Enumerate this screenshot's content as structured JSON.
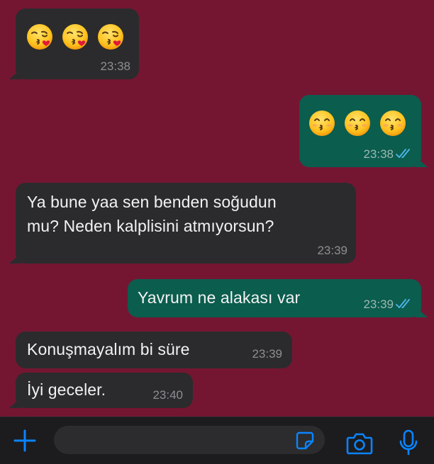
{
  "messages": [
    {
      "direction": "incoming",
      "emoji": [
        "kissing-heart",
        "kissing-heart",
        "kissing-heart"
      ],
      "time": "23:38"
    },
    {
      "direction": "outgoing",
      "emoji": [
        "kissing-smiling-eyes",
        "kissing-smiling-eyes",
        "kissing-smiling-eyes"
      ],
      "time": "23:38",
      "status": "read"
    },
    {
      "direction": "incoming",
      "text_line1": "Ya bune yaa sen benden soğudun",
      "text_line2": "mu? Neden kalplisini atmıyorsun?",
      "time": "23:39"
    },
    {
      "direction": "outgoing",
      "text": "Yavrum ne alakası var",
      "time": "23:39",
      "status": "read"
    },
    {
      "direction": "incoming",
      "text": "Konuşmayalım bi süre",
      "time": "23:39"
    },
    {
      "direction": "incoming",
      "text": "İyi geceler.",
      "time": "23:40"
    }
  ],
  "composer": {
    "placeholder": "",
    "value": "",
    "icons": [
      "plus-icon",
      "sticker-icon",
      "camera-icon",
      "microphone-icon"
    ]
  },
  "colors": {
    "background": "#741632",
    "incoming_bubble": "#2b2b2d",
    "outgoing_bubble": "#0b5d4e",
    "accent": "#0a84ff",
    "read_ticks": "#4fb6ec"
  }
}
